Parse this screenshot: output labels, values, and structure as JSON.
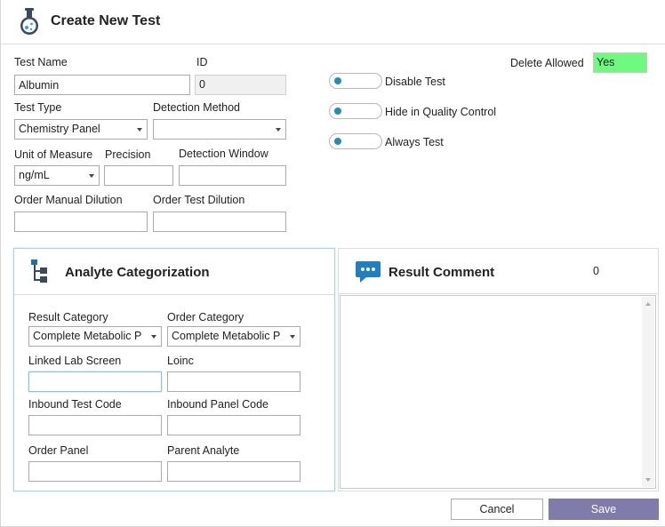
{
  "header": {
    "title": "Create New Test",
    "icon": "flask-icon"
  },
  "form": {
    "test_name": {
      "label": "Test Name",
      "value": "Albumin"
    },
    "id": {
      "label": "ID",
      "value": "0"
    },
    "test_type": {
      "label": "Test Type",
      "value": "Chemistry Panel"
    },
    "detection_method": {
      "label": "Detection Method",
      "value": ""
    },
    "unit_of_measure": {
      "label": "Unit of Measure",
      "value": "ng/mL"
    },
    "precision": {
      "label": "Precision",
      "value": ""
    },
    "detection_window": {
      "label": "Detection Window",
      "value": ""
    },
    "order_manual_dilution": {
      "label": "Order Manual Dilution",
      "value": ""
    },
    "order_test_dilution": {
      "label": "Order Test Dilution",
      "value": ""
    },
    "delete_allowed": {
      "label": "Delete Allowed",
      "value": "Yes",
      "color": "#6dfa7f"
    },
    "toggles": [
      {
        "label": "Disable Test"
      },
      {
        "label": "Hide in Quality Control"
      },
      {
        "label": "Always Test"
      }
    ]
  },
  "analyte": {
    "title": "Analyte Categorization",
    "icon": "hierarchy-icon",
    "result_category": {
      "label": "Result Category",
      "value": "Complete Metabolic P"
    },
    "order_category": {
      "label": "Order Category",
      "value": "Complete Metabolic P"
    },
    "linked_lab_screen": {
      "label": "Linked Lab Screen",
      "value": ""
    },
    "loinc": {
      "label": "Loinc",
      "value": ""
    },
    "inbound_test_code": {
      "label": "Inbound Test Code",
      "value": ""
    },
    "inbound_panel_code": {
      "label": "Inbound Panel Code",
      "value": ""
    },
    "order_panel": {
      "label": "Order Panel",
      "value": ""
    },
    "parent_analyte": {
      "label": "Parent Analyte",
      "value": ""
    }
  },
  "result_comment": {
    "title": "Result Comment",
    "count": "0",
    "icon": "comment-bubble-icon",
    "text": ""
  },
  "actions": {
    "cancel_label": "Cancel",
    "save_label": "Save"
  },
  "colors": {
    "accent": "#1f8fb8",
    "save_button": "#7f7bab",
    "panel_border": "#a9d2e4"
  }
}
